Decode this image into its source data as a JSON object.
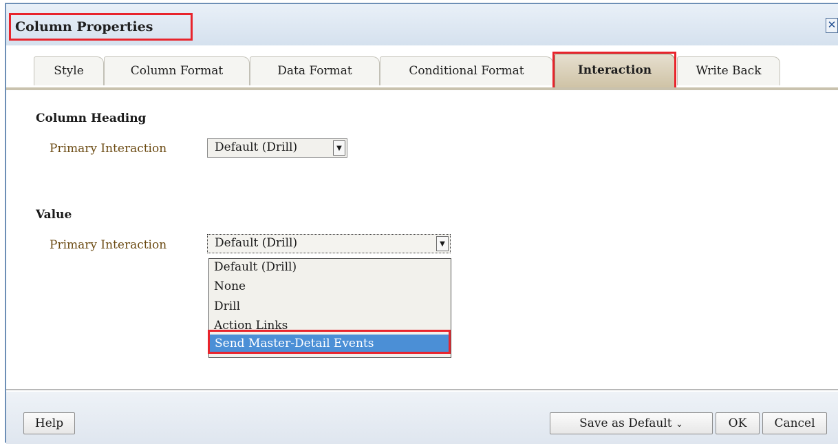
{
  "dialog": {
    "title": "Column Properties",
    "close_icon": "close-icon",
    "tabs": [
      {
        "label": "Style"
      },
      {
        "label": "Column Format"
      },
      {
        "label": "Data Format"
      },
      {
        "label": "Conditional Format"
      },
      {
        "label": "Interaction",
        "active": true
      },
      {
        "label": "Write Back"
      }
    ],
    "column_heading": {
      "heading": "Column Heading",
      "primary_interaction_label": "Primary Interaction",
      "primary_interaction_value": "Default (Drill)"
    },
    "value": {
      "heading": "Value",
      "primary_interaction_label": "Primary Interaction",
      "primary_interaction_value": "Default (Drill)",
      "options": [
        "Default (Drill)",
        "None",
        "Drill",
        "Action Links",
        "Send Master-Detail Events"
      ],
      "highlighted_option": "Send Master-Detail Events"
    },
    "footer": {
      "help_label": "Help",
      "save_default_label": "Save as Default",
      "ok_label": "OK",
      "cancel_label": "Cancel"
    }
  },
  "colors": {
    "highlight_annotation": "#e8242c",
    "selected_option_bg": "#4b8fd6",
    "active_tab_bg": "#cfc3a6",
    "label_text": "#6b4a12"
  }
}
